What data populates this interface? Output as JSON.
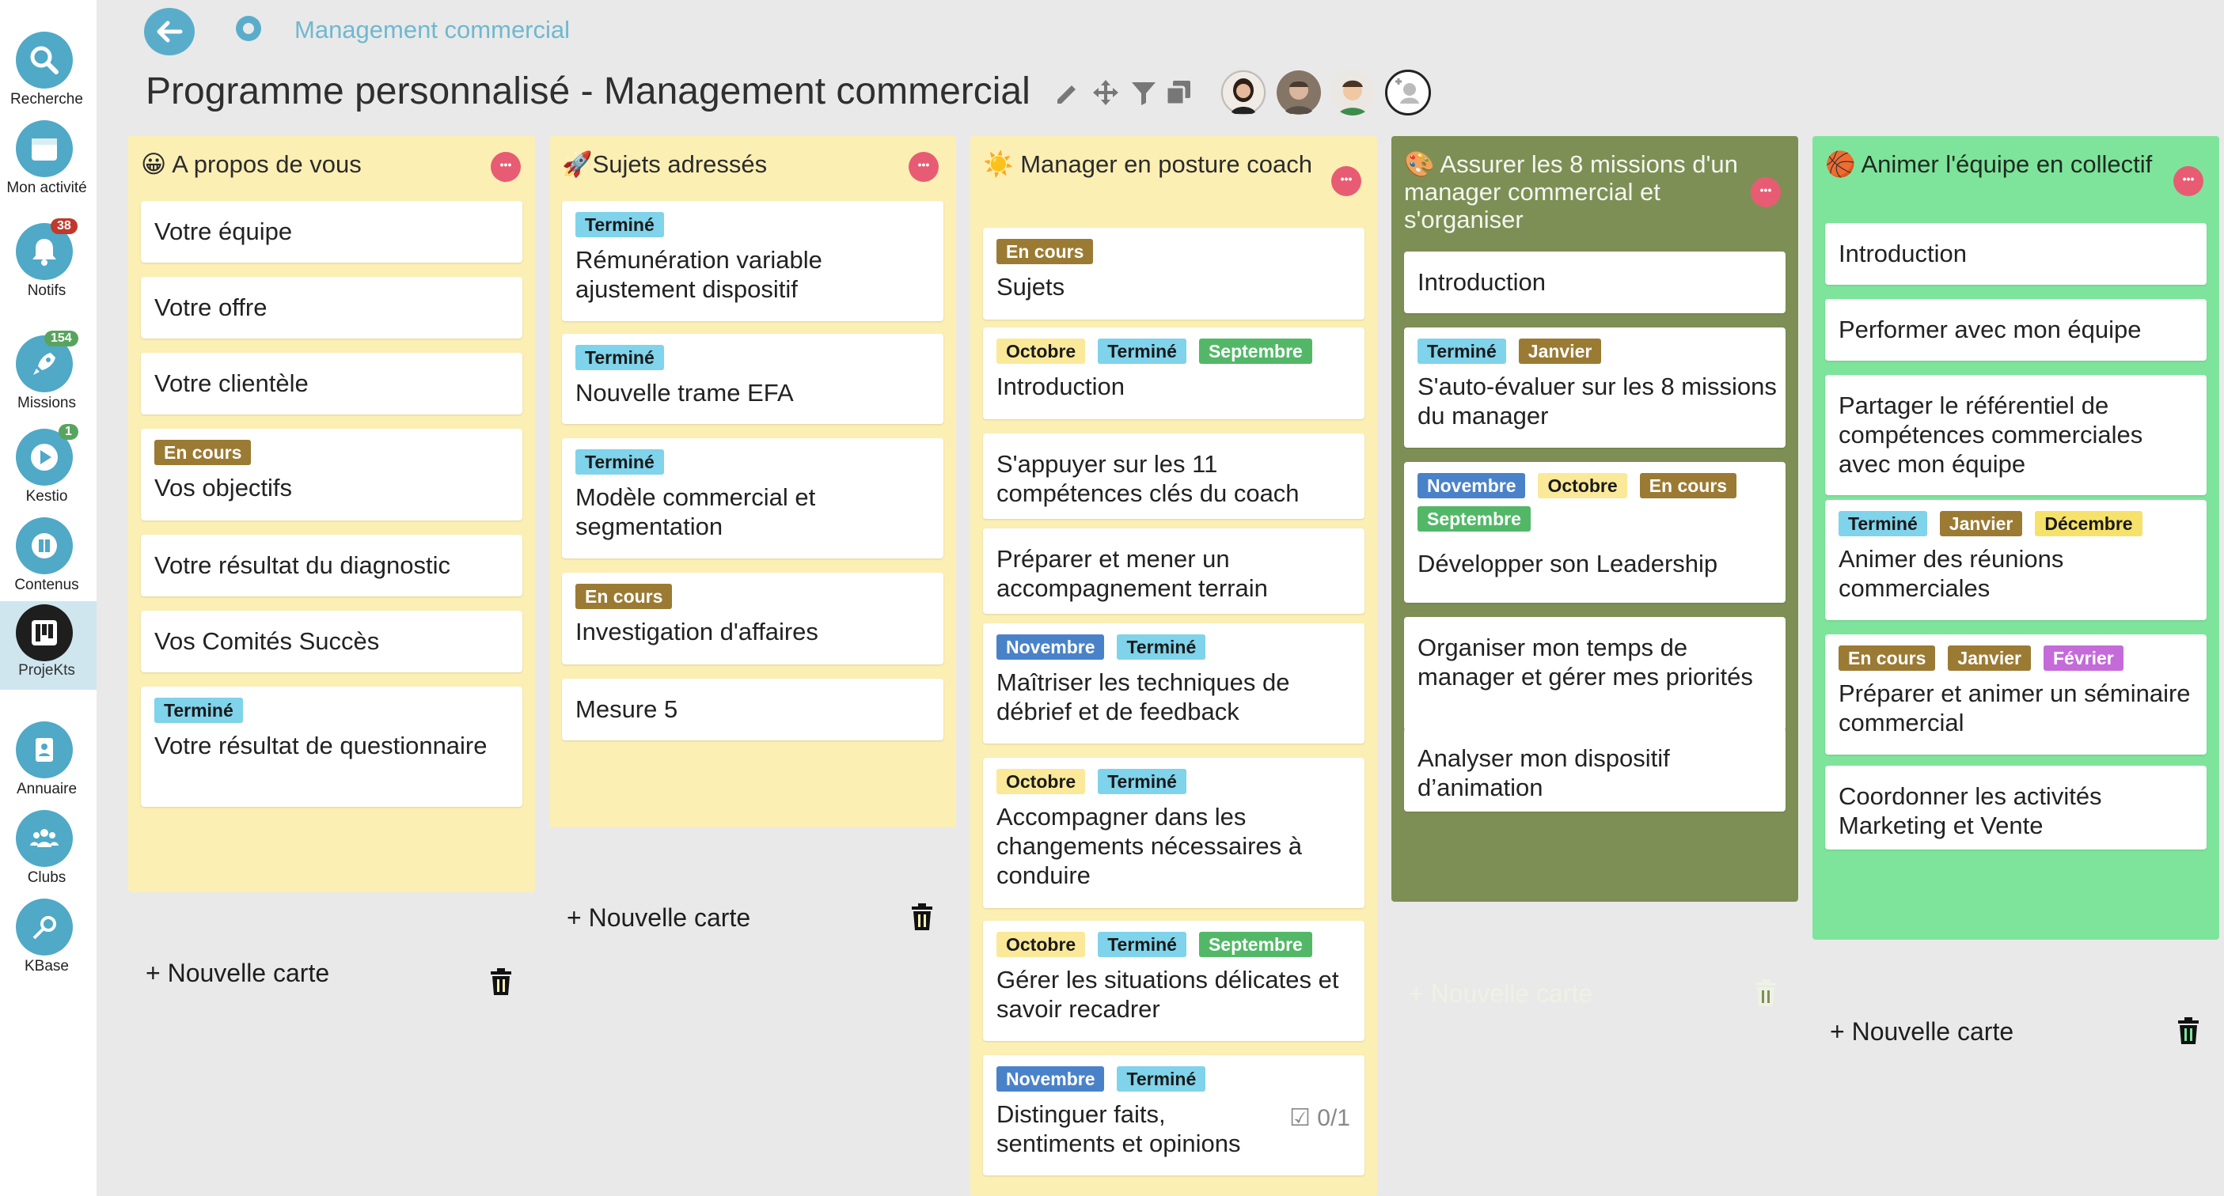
{
  "sidebar": {
    "items": [
      {
        "label": "Recherche",
        "icon": "search-icon"
      },
      {
        "label": "Mon activité",
        "icon": "calendar-icon"
      },
      {
        "label": "Notifs",
        "icon": "bell-icon",
        "badge": "38"
      },
      {
        "label": "Missions",
        "icon": "rocket-icon",
        "badge": "154"
      },
      {
        "label": "Kestio",
        "icon": "play-icon",
        "badge": "1"
      },
      {
        "label": "Contenus",
        "icon": "book-icon"
      },
      {
        "label": "ProjeKts",
        "icon": "board-icon"
      },
      {
        "label": "Annuaire",
        "icon": "contacts-icon"
      },
      {
        "label": "Clubs",
        "icon": "group-icon"
      },
      {
        "label": "KBase",
        "icon": "key-icon"
      }
    ]
  },
  "header": {
    "breadcrumb": "Management commercial",
    "title": "Programme personnalisé - Management commercial"
  },
  "new_card_label": "+ Nouvelle carte",
  "colors": {
    "accent": "#4fa9c7",
    "yellow_col": "#fcefb4",
    "olive_col": "#7d8f55",
    "green_col": "#7ee49b",
    "menu": "#e85c73"
  },
  "columns": [
    {
      "title": "😀 A propos de vous",
      "cards": [
        {
          "text": "Votre équipe",
          "tags": []
        },
        {
          "text": "Votre offre",
          "tags": []
        },
        {
          "text": "Votre clientèle",
          "tags": []
        },
        {
          "text": "Vos objectifs",
          "tags": [
            "En cours"
          ]
        },
        {
          "text": "Votre résultat du diagnostic",
          "tags": []
        },
        {
          "text": "Vos Comités Succès",
          "tags": []
        },
        {
          "text": "Votre résultat de questionnaire",
          "tags": [
            "Terminé"
          ]
        }
      ]
    },
    {
      "title": "🚀Sujets adressés",
      "cards": [
        {
          "text": "Rémunération variable ajustement dispositif",
          "tags": [
            "Terminé"
          ]
        },
        {
          "text": "Nouvelle trame EFA",
          "tags": [
            "Terminé"
          ]
        },
        {
          "text": "Modèle commercial et segmentation",
          "tags": [
            "Terminé"
          ]
        },
        {
          "text": "Investigation d'affaires",
          "tags": [
            "En cours"
          ]
        },
        {
          "text": "Mesure 5",
          "tags": []
        }
      ]
    },
    {
      "title": "☀️ Manager en posture coach",
      "cards": [
        {
          "text": "Sujets",
          "tags": [
            "En cours"
          ]
        },
        {
          "text": "Introduction",
          "tags": [
            "Octobre",
            "Terminé",
            "Septembre"
          ]
        },
        {
          "text": "S'appuyer sur les 11 compétences clés du coach",
          "tags": []
        },
        {
          "text": "Préparer et mener un accompagnement terrain",
          "tags": []
        },
        {
          "text": "Maîtriser les techniques de débrief et de feedback",
          "tags": [
            "Novembre",
            "Terminé"
          ]
        },
        {
          "text": "Accompagner dans les changements nécessaires à conduire",
          "tags": [
            "Octobre",
            "Terminé"
          ]
        },
        {
          "text": "Gérer les situations délicates et savoir recadrer",
          "tags": [
            "Octobre",
            "Terminé",
            "Septembre"
          ]
        },
        {
          "text": "Distinguer faits, sentiments et opinions",
          "tags": [
            "Novembre",
            "Terminé"
          ],
          "checklist": "0/1"
        }
      ]
    },
    {
      "title": "🎨 Assurer les 8 missions d'un manager commercial et s'organiser",
      "cards": [
        {
          "text": "Introduction",
          "tags": []
        },
        {
          "text": "S'auto-évaluer sur les 8 missions du manager",
          "tags": [
            "Terminé",
            "Janvier"
          ]
        },
        {
          "text": "Développer son Leadership",
          "tags": [
            "Novembre",
            "Octobre",
            "En cours",
            "Septembre"
          ]
        },
        {
          "text": "Organiser mon temps de manager et gérer mes priorités",
          "tags": []
        },
        {
          "text": "Analyser mon dispositif d’animation",
          "tags": []
        }
      ]
    },
    {
      "title": "🏀 Animer l'équipe en collectif",
      "cards": [
        {
          "text": "Introduction",
          "tags": []
        },
        {
          "text": "Performer avec mon équipe",
          "tags": []
        },
        {
          "text": "Partager le référentiel de compétences commerciales avec mon équipe",
          "tags": []
        },
        {
          "text": "Animer des réunions commerciales",
          "tags": [
            "Terminé",
            "Janvier",
            "Décembre"
          ]
        },
        {
          "text": "Préparer et animer un séminaire commercial",
          "tags": [
            "En cours",
            "Janvier",
            "Février"
          ]
        },
        {
          "text": "Coordonner les activités Marketing et Vente",
          "tags": []
        }
      ]
    }
  ]
}
